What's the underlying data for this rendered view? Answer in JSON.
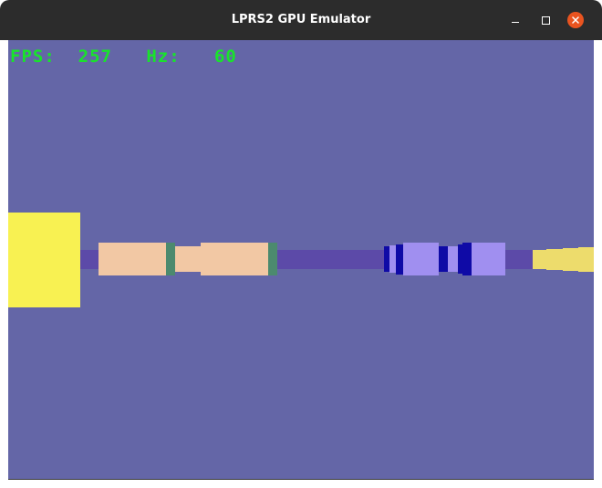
{
  "window": {
    "title": "LPRS2 GPU Emulator",
    "controls": [
      "minimize-icon",
      "maximize-icon",
      "close-icon"
    ],
    "close_color": "#e95420"
  },
  "hud": {
    "fps_label": "FPS:",
    "fps_value": "257",
    "hz_label": "Hz:",
    "hz_value": "60",
    "color": "#19e32b"
  },
  "scene": {
    "background": "#6466a7",
    "colors": {
      "rail": "#5c4aa8",
      "yellow_near": "#f8f152",
      "yellow_far": "#eddc6c",
      "peach": "#f2c8a4",
      "green_band": "#4c8a6e",
      "lavender": "#a08ff0",
      "dark_blue": "#0f0aa6"
    }
  }
}
